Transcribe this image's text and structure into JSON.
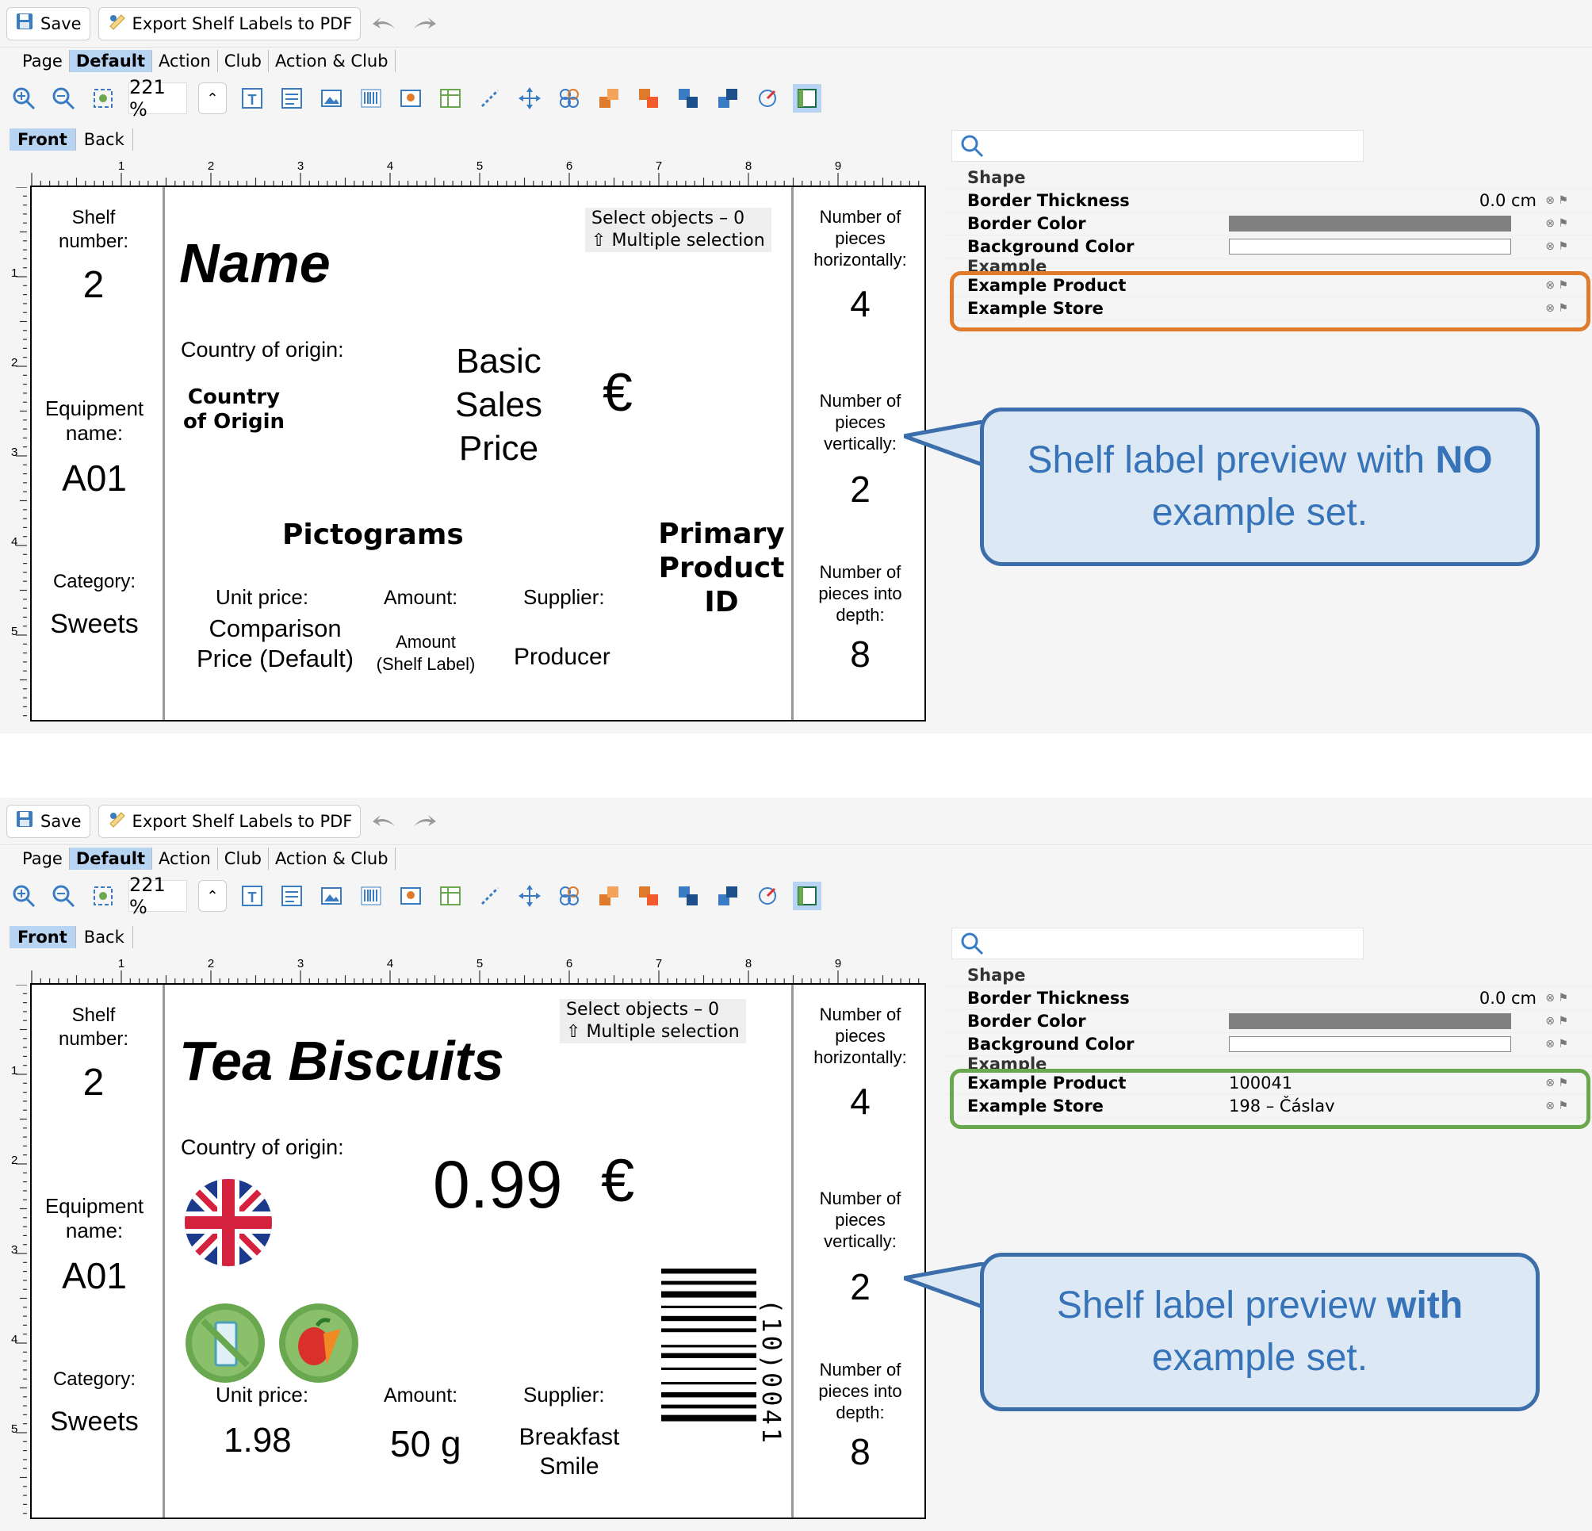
{
  "toolbar": {
    "save_label": "Save",
    "export_label": "Export Shelf Labels to PDF"
  },
  "page_tabs": [
    "Page",
    "Default",
    "Action",
    "Club",
    "Action & Club"
  ],
  "zoom_value": "221 %",
  "side_tabs": [
    "Front",
    "Back"
  ],
  "ruler_ticks": [
    "1",
    "2",
    "3",
    "4",
    "5",
    "6",
    "7",
    "8",
    "9"
  ],
  "ruler_v_ticks": [
    "1",
    "2",
    "3",
    "4",
    "5"
  ],
  "label_common": {
    "shelf_number_label": "Shelf number:",
    "shelf_number": "2",
    "equipment_label": "Equipment name:",
    "equipment": "A01",
    "category_label": "Category:",
    "category": "Sweets",
    "horiz_label": "Number of pieces horizontally:",
    "horiz": "4",
    "vert_label": "Number of pieces vertically:",
    "vert": "2",
    "depth_label": "Number of pieces into depth:",
    "depth": "8",
    "country_label": "Country of origin:",
    "unit_price_label": "Unit price:",
    "amount_label": "Amount:",
    "supplier_label": "Supplier:",
    "select_objects": "Select objects – 0",
    "multiple_selection": "Multiple selection"
  },
  "label_no_example": {
    "name": "Name",
    "country": "Country of Origin",
    "price": "Basic Sales Price",
    "currency": "€",
    "pictograms": "Pictograms",
    "primary_id": "Primary Product ID",
    "unit_price": "Comparison Price (Default)",
    "amount": "Amount (Shelf Label)",
    "supplier": "Producer"
  },
  "label_example": {
    "name": "Tea Biscuits",
    "price": "0.99",
    "currency": "€",
    "barcode_text": "(10)0041",
    "unit_price": "1.98",
    "amount": "50 g",
    "supplier": "Breakfast Smile"
  },
  "props": {
    "section_shape": "Shape",
    "border_thickness": "Border Thickness",
    "border_thickness_value": "0.0 cm",
    "border_color": "Border Color",
    "background_color": "Background Color",
    "section_example": "Example",
    "example_product": "Example Product",
    "example_store": "Example Store",
    "example_product_value": "100041",
    "example_store_value": "198 – Čáslav"
  },
  "callouts": {
    "top_pre": "Shelf label preview with ",
    "top_bold": "NO",
    "top_post": " example set.",
    "bottom_pre": "Shelf label preview ",
    "bottom_bold": "with",
    "bottom_post": " example set."
  },
  "colors": {
    "orange": "#e07b2b",
    "green": "#6aa84f",
    "callout_text": "#3673b8",
    "callout_border": "#3b6eaa",
    "tab_active": "#b7d4f2"
  }
}
